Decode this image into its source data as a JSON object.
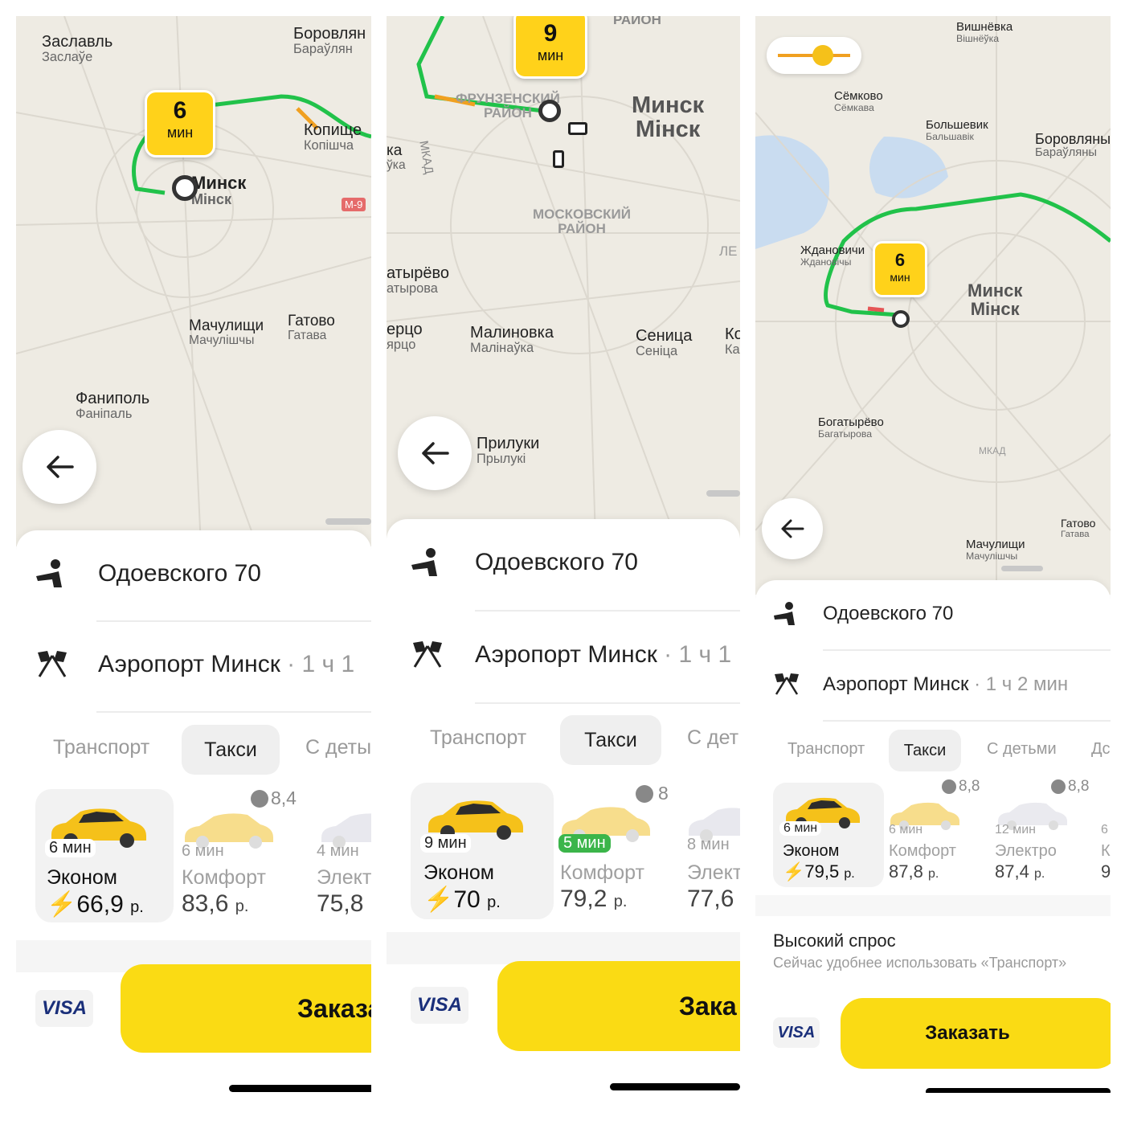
{
  "screens": [
    {
      "map": {
        "eta_value": "6",
        "eta_unit": "мин",
        "places": [
          {
            "a": "Заславль",
            "b": "Заслаўе"
          },
          {
            "a": "Боровлян",
            "b": "Бараўлян"
          },
          {
            "a": "Копище",
            "b": "Копішча"
          },
          {
            "a": "Минск",
            "b": "Мінск"
          },
          {
            "a": "Мачулищи",
            "b": "Мачулішчы"
          },
          {
            "a": "Гатово",
            "b": "Гатава"
          },
          {
            "a": "Фаниполь",
            "b": "Фаніпаль"
          }
        ],
        "road_badge": "М-9"
      },
      "from": "Одоевского 70",
      "to": "Аэропорт Минск",
      "to_duration": "· 1 ч 1",
      "tabs": [
        "Транспорт",
        "Такси",
        "С деты"
      ],
      "tariffs": [
        {
          "eta": "6 мин",
          "name": "Эконом",
          "price": "66,9",
          "unit": "р.",
          "bolt": true
        },
        {
          "eta": "6 мин",
          "name": "Комфорт",
          "price": "83,6",
          "unit": "р.",
          "points": "8,4"
        },
        {
          "eta": "4 мин",
          "name": "Элект",
          "price": "75,8",
          "unit": ""
        }
      ],
      "payment": "VISA",
      "order_label": "Заказа"
    },
    {
      "map": {
        "eta_value": "9",
        "eta_unit": "мин",
        "places": [
          {
            "a": "РАЙОН",
            "b": ""
          },
          {
            "a": "ФРУНЗЕНСКИЙ",
            "b": "РАЙОН"
          },
          {
            "a": "Минск",
            "b": "Мінск"
          },
          {
            "a": "МКАД",
            "b": ""
          },
          {
            "a": "ка",
            "b": "ўка"
          },
          {
            "a": "МОСКОВСКИЙ",
            "b": "РАЙОН"
          },
          {
            "a": "ЛЕ",
            "b": ""
          },
          {
            "a": "атырёво",
            "b": "атырова"
          },
          {
            "a": "ерцо",
            "b": "ярцо"
          },
          {
            "a": "Малиновка",
            "b": "Малінаўка"
          },
          {
            "a": "Сеница",
            "b": "Сеніца"
          },
          {
            "a": "Ко",
            "b": "Ка"
          },
          {
            "a": "Прилуки",
            "b": "Прылукі"
          }
        ]
      },
      "from": "Одоевского 70",
      "to": "Аэропорт Минск",
      "to_duration": "· 1 ч 1",
      "tabs": [
        "Транспорт",
        "Такси",
        "С дет"
      ],
      "tariffs": [
        {
          "eta": "9 мин",
          "name": "Эконом",
          "price": "70",
          "unit": "р.",
          "bolt": true
        },
        {
          "eta": "5 мин",
          "name": "Комфорт",
          "price": "79,2",
          "unit": "р.",
          "points": "8"
        },
        {
          "eta": "8 мин",
          "name": "Элект",
          "price": "77,6",
          "unit": ""
        }
      ],
      "payment": "VISA",
      "order_label": "Зака"
    },
    {
      "map": {
        "eta_value": "6",
        "eta_unit": "мин",
        "places": [
          {
            "a": "Вишнёвка",
            "b": "Вішнёўка"
          },
          {
            "a": "Сёмково",
            "b": "Сёмкава"
          },
          {
            "a": "Большевик",
            "b": "Бальшавік"
          },
          {
            "a": "Боровляны",
            "b": "Бараўляны"
          },
          {
            "a": "Ждановичи",
            "b": "Ждановічы"
          },
          {
            "a": "Минск",
            "b": "Мінск"
          },
          {
            "a": "Богатырёво",
            "b": "Багатырова"
          },
          {
            "a": "Гатово",
            "b": "Гатава"
          },
          {
            "a": "Мачулищи",
            "b": "Мачулішчы"
          },
          {
            "a": "МКАД",
            "b": ""
          }
        ]
      },
      "from": "Одоевского 70",
      "to": "Аэропорт Минск",
      "to_duration": "· 1 ч 2 мин",
      "tabs": [
        "Транспорт",
        "Такси",
        "С детьми",
        "Дс"
      ],
      "tariffs": [
        {
          "eta": "6 мин",
          "name": "Эконом",
          "price": "79,5",
          "unit": "р.",
          "bolt": true
        },
        {
          "eta": "6 мин",
          "name": "Комфорт",
          "price": "87,8",
          "unit": "р.",
          "points": "8,8"
        },
        {
          "eta": "12 мин",
          "name": "Электро",
          "price": "87,4",
          "unit": "р.",
          "points": "8,8"
        },
        {
          "eta": "6",
          "name": "К",
          "price": "9",
          "unit": ""
        }
      ],
      "notice": {
        "title": "Высокий спрос",
        "text": "Сейчас удобнее использовать «Транспорт»"
      },
      "payment": "VISA",
      "order_label": "Заказать"
    }
  ],
  "colors": {
    "accent": "#fadb14",
    "route": "#21c24a",
    "map_bg": "#eeebe3",
    "water": "#c9dcf0"
  }
}
